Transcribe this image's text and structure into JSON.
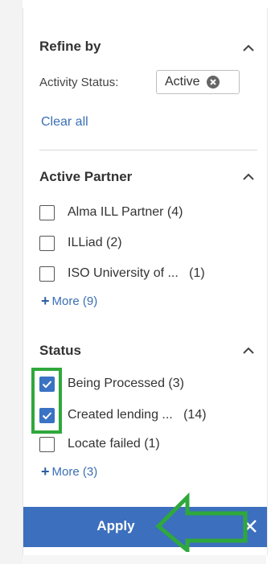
{
  "refine": {
    "title": "Refine by",
    "filter_label": "Activity Status:",
    "chip_value": "Active",
    "clear_all": "Clear all"
  },
  "active_partner": {
    "title": "Active Partner",
    "items": [
      {
        "label": "Alma ILL Partner",
        "count": "(4)",
        "checked": false
      },
      {
        "label": "ILLiad",
        "count": "(2)",
        "checked": false
      },
      {
        "label": "ISO University of ...",
        "count": "(1)",
        "checked": false
      }
    ],
    "more": "More (9)"
  },
  "status": {
    "title": "Status",
    "items": [
      {
        "label": "Being Processed",
        "count": "(3)",
        "checked": true
      },
      {
        "label": "Created lending ...",
        "count": "(14)",
        "checked": true
      },
      {
        "label": "Locate failed",
        "count": "(1)",
        "checked": false
      }
    ],
    "more": "More (3)"
  },
  "footer": {
    "apply_label": "Apply"
  },
  "colors": {
    "accent": "#3c6fbd",
    "link": "#3a6fb5",
    "highlight": "#2fa83c"
  },
  "icons": {
    "collapse": "chevron-up-icon",
    "chip_remove": "clear-circle-icon",
    "more": "plus-icon",
    "close": "close-icon",
    "annotation": "arrow-left-icon"
  }
}
